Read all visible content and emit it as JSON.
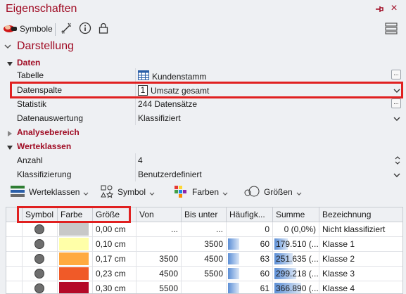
{
  "window": {
    "title": "Eigenschaften",
    "close_glyph": "×"
  },
  "toolbar": {
    "symbols_label": "Symbole"
  },
  "section": {
    "title": "Darstellung"
  },
  "categories": {
    "data": "Daten",
    "analysis": "Analysebereich",
    "classes": "Werteklassen"
  },
  "properties": {
    "table": {
      "label": "Tabelle",
      "value": "Kundenstamm"
    },
    "data_column": {
      "label": "Datenspalte",
      "value": "Umsatz gesamt",
      "type_glyph": "1"
    },
    "statistics": {
      "label": "Statistik",
      "value": "244 Datensätze"
    },
    "evaluation": {
      "label": "Datenauswertung",
      "value": "Klassifiziert"
    },
    "count": {
      "label": "Anzahl",
      "value": "4"
    },
    "classification": {
      "label": "Klassifizierung",
      "value": "Benutzerdefiniert"
    }
  },
  "buttons": {
    "value_classes": "Werteklassen",
    "symbol": "Symbol",
    "colors": "Farben",
    "sizes": "Größen"
  },
  "table": {
    "columns": [
      "Symbol",
      "Farbe",
      "Größe",
      "Von",
      "Bis unter",
      "Häufigk...",
      "Summe",
      "Bezeichnung"
    ],
    "rows": [
      {
        "color": "#c8c8c8",
        "size": "0,00 cm",
        "from": "...",
        "to": "...",
        "freq": "0",
        "freq_fraction": 0,
        "sum": "0 (0,0%)",
        "sum_fraction": 0,
        "label": "Nicht klassifiziert"
      },
      {
        "color": "#ffffa8",
        "size": "0,10 cm",
        "from": "",
        "to": "3500",
        "freq": "60",
        "freq_fraction": 0.25,
        "sum": "179.510 (...",
        "sum_fraction": 0.3,
        "label": "Klasse 1"
      },
      {
        "color": "#ffaa40",
        "size": "0,17 cm",
        "from": "3500",
        "to": "4500",
        "freq": "63",
        "freq_fraction": 0.26,
        "sum": "251.635 (...",
        "sum_fraction": 0.42,
        "label": "Klasse 2"
      },
      {
        "color": "#f05a28",
        "size": "0,23 cm",
        "from": "4500",
        "to": "5500",
        "freq": "60",
        "freq_fraction": 0.25,
        "sum": "299.218 (...",
        "sum_fraction": 0.5,
        "label": "Klasse 3"
      },
      {
        "color": "#b40a28",
        "size": "0,30 cm",
        "from": "5500",
        "to": "",
        "freq": "61",
        "freq_fraction": 0.25,
        "sum": "366.890 (...",
        "sum_fraction": 0.62,
        "label": "Klasse 4"
      }
    ]
  },
  "colors": {
    "accent": "#a00c24",
    "highlight": "#e02020"
  }
}
